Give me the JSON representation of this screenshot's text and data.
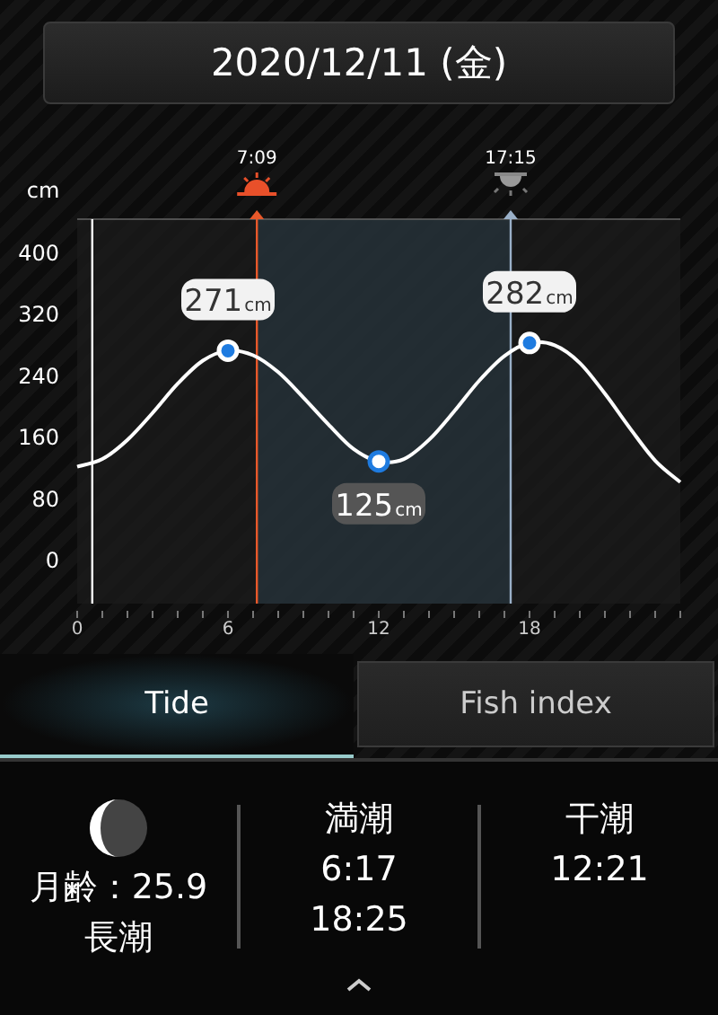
{
  "date_button": "2020/12/11 (金)",
  "sun_times": [
    {
      "kind": "sunrise",
      "time": "7:09"
    },
    {
      "kind": "sunset",
      "time": "17:15"
    }
  ],
  "chart": {
    "chart_data": {
      "type": "line",
      "ylabel": "cm",
      "x": [
        0,
        1,
        2,
        3,
        4,
        5,
        6,
        7,
        8,
        9,
        10,
        11,
        12,
        13,
        14,
        15,
        16,
        17,
        18,
        19,
        20,
        21,
        22,
        23,
        24
      ],
      "xlim": [
        0,
        24
      ],
      "ylim": [
        -58,
        442
      ],
      "xticks": [
        0,
        6,
        12,
        18
      ],
      "yticks": [
        0,
        80,
        160,
        240,
        320,
        400
      ],
      "series": [
        {
          "color": "#ffffff",
          "values": [
            120,
            130,
            155,
            190,
            228,
            258,
            271,
            265,
            243,
            210,
            175,
            143,
            127,
            130,
            155,
            192,
            232,
            264,
            281,
            278,
            255,
            215,
            170,
            128,
            100
          ]
        }
      ],
      "ref_lines": [
        {
          "axis": "x",
          "value": 0.6,
          "color": "#ffffff"
        },
        {
          "axis": "x",
          "value": 7.15,
          "color": "#e8582a"
        },
        {
          "axis": "x",
          "value": 17.25,
          "color": "#9ab0c8"
        }
      ],
      "bands": [
        {
          "axis": "x",
          "from": 7.15,
          "to": 17.25,
          "color": "#2a3a44"
        }
      ],
      "annotations": [
        {
          "x": 6,
          "y": 271,
          "text": "271cm"
        },
        {
          "x": 12,
          "y": 127,
          "text": "125cm"
        },
        {
          "x": 18,
          "y": 281,
          "text": "282cm"
        }
      ]
    }
  },
  "tabs": [
    {
      "label": "Tide",
      "selected": true
    },
    {
      "label": "Fish index",
      "selected": false
    }
  ],
  "moon": {
    "age_label": "月齢：25.9",
    "tide_name": "長潮"
  },
  "columns": [
    {
      "title": "満潮",
      "times": [
        "6:17",
        "18:25"
      ]
    },
    {
      "title": "干潮",
      "times": [
        "12:21"
      ]
    }
  ]
}
